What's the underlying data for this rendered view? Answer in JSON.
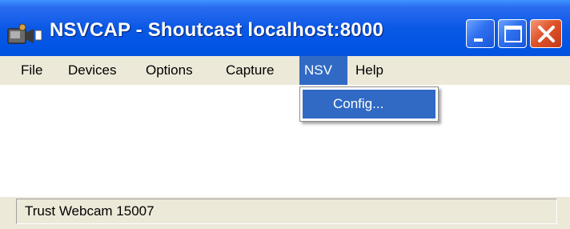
{
  "window": {
    "title": "NSVCAP - Shoutcast localhost:8000",
    "icon": "camera-icon"
  },
  "title_buttons": [
    "minimize-icon",
    "maximize-icon",
    "close-icon"
  ],
  "menubar": {
    "items": [
      {
        "label": "File"
      },
      {
        "label": "Devices"
      },
      {
        "label": "Options"
      },
      {
        "label": "Capture"
      },
      {
        "label": "NSV",
        "active": true
      },
      {
        "label": "Help"
      }
    ]
  },
  "nsv_menu": {
    "items": [
      {
        "label": "Config...",
        "highlighted": true
      }
    ]
  },
  "statusbar": {
    "text": "Trust Webcam 15007"
  },
  "colors": {
    "titlebar": "#0054e3",
    "highlight": "#316ac5",
    "close_button": "#e0532b",
    "chrome": "#ece9d8"
  }
}
